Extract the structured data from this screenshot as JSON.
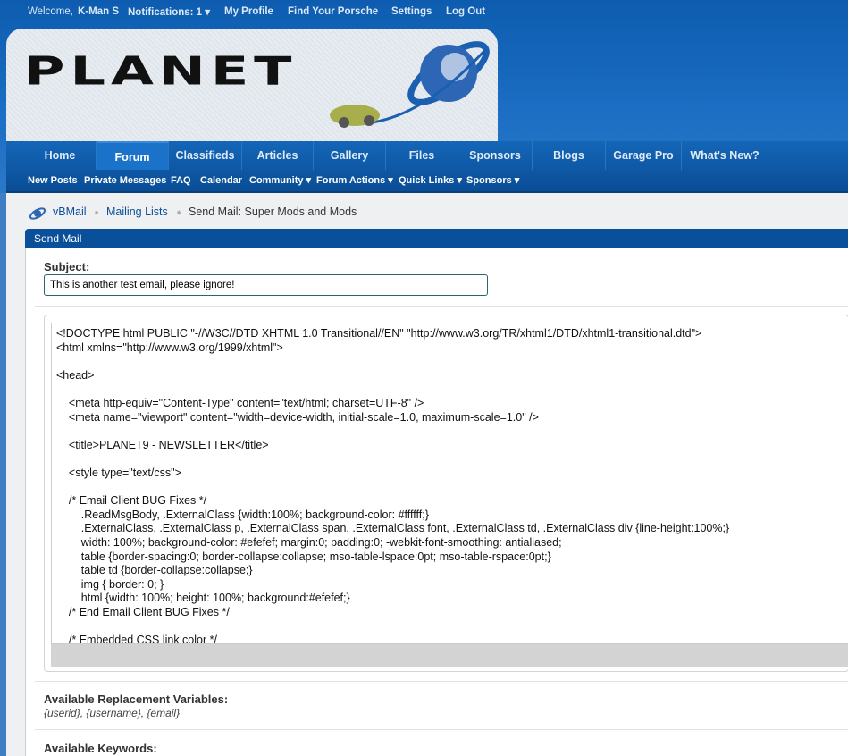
{
  "topbar": {
    "welcome": "Welcome,",
    "user": "K-Man S",
    "notifications": "Notifications: 1 ▾",
    "profile": "My Profile",
    "find": "Find Your Porsche",
    "settings": "Settings",
    "logout": "Log Out"
  },
  "logo": {
    "text": "PLANET"
  },
  "nav": {
    "tabs": [
      "Home",
      "Forum",
      "Classifieds",
      "Articles",
      "Gallery",
      "Files",
      "Sponsors",
      "Blogs",
      "Garage Pro",
      "What's New?"
    ],
    "active": "Forum",
    "sub": [
      "New Posts",
      "Private Messages",
      "FAQ",
      "Calendar",
      "Community ▾",
      "Forum Actions ▾",
      "Quick Links ▾",
      "Sponsors ▾"
    ]
  },
  "breadcrumb": {
    "items": [
      "vBMail",
      "Mailing Lists"
    ],
    "current": "Send Mail: Super Mods and Mods",
    "sep": "➧"
  },
  "panel": {
    "title": "Send Mail",
    "subject_label": "Subject:",
    "subject_value": "This is another test email, please ignore!",
    "body": "<!DOCTYPE html PUBLIC \"-//W3C//DTD XHTML 1.0 Transitional//EN\" \"http://www.w3.org/TR/xhtml1/DTD/xhtml1-transitional.dtd\">\n<html xmlns=\"http://www.w3.org/1999/xhtml\">\n\n<head>\n\n    <meta http-equiv=\"Content-Type\" content=\"text/html; charset=UTF-8\" />\n    <meta name=\"viewport\" content=\"width=device-width, initial-scale=1.0, maximum-scale=1.0\" />\n\n    <title>PLANET9 - NEWSLETTER</title>\n\n    <style type=\"text/css\">\n\n    /* Email Client BUG Fixes */\n        .ReadMsgBody, .ExternalClass {width:100%; background-color: #ffffff;}\n        .ExternalClass, .ExternalClass p, .ExternalClass span, .ExternalClass font, .ExternalClass td, .ExternalClass div {line-height:100%;}\n        width: 100%; background-color: #efefef; margin:0; padding:0; -webkit-font-smoothing: antialiased;\n        table {border-spacing:0; border-collapse:collapse; mso-table-lspace:0pt; mso-table-rspace:0pt;}\n        table td {border-collapse:collapse;}\n        img { border: 0; }\n        html {width: 100%; height: 100%; background:#efefef;}\n    /* End Email Client BUG Fixes */\n\n    /* Embedded CSS link color */",
    "vars_label": "Available Replacement Variables:",
    "vars": "{userid}, {username}, {email}",
    "keywords_label": "Available Keywords:"
  },
  "colors": {
    "header": "#0d5cb0",
    "nav": "#0a4d96",
    "panel_header": "#0a4f9a",
    "link": "#0b4f9c"
  }
}
